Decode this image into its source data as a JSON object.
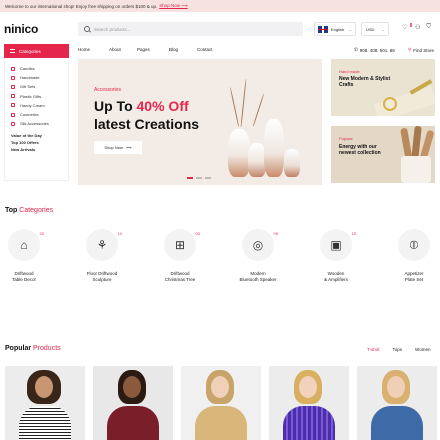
{
  "topbar": {
    "message": "Welcome to our international shop! Enjoy free shipping on orders $100 & up.",
    "link": "Shop Now"
  },
  "header": {
    "logo": "ninico",
    "search_placeholder": "Search products...",
    "language": "English",
    "currency": "USD",
    "wishlist_count": "0",
    "phone": "908. 408. 501. 89",
    "find_store": "Find Store"
  },
  "categories_button": "Categories",
  "nav": [
    "Home",
    "About",
    "Pages",
    "Blog",
    "Contact"
  ],
  "sidebar": {
    "items": [
      "Candles",
      "Handmade",
      "Gift Sets",
      "Plastic Gifts",
      "Handy Cream",
      "Cosmetics",
      "Silk Accessories"
    ],
    "extras": [
      "Value of the Day",
      "Top 100 Offers",
      "New Arrivals"
    ]
  },
  "hero": {
    "tag": "Accessories",
    "title_a": "Up To ",
    "title_accent": "40% Off",
    "title_b": "latest Creations",
    "button": "Shop Now"
  },
  "promos": [
    {
      "tag": "Hand made",
      "title": "New Modern & Stylist Crafts"
    },
    {
      "tag": "Popular",
      "title": "Energy with our newest collection"
    }
  ],
  "top_categories": {
    "title_a": "Top",
    "title_b": "Categories",
    "items": [
      {
        "label": "Driftwood\nTable Decor",
        "count": "20",
        "icon": "lamp-icon"
      },
      {
        "label": "Floor Driftwood\nSculpture",
        "count": "10",
        "icon": "sculpture-icon"
      },
      {
        "label": "Driftwood\nChristmas Tree",
        "count": "03",
        "icon": "gift-icon"
      },
      {
        "label": "Modern\nBluetooth Speaker",
        "count": "09",
        "icon": "speaker-icon"
      },
      {
        "label": "Wooden\n& Amplifiers",
        "count": "15",
        "icon": "amplifier-icon"
      },
      {
        "label": "Appetizer\nPlate Set",
        "count": "",
        "icon": "plate-icon"
      }
    ]
  },
  "popular": {
    "title_a": "Popular",
    "title_b": "Products",
    "tabs": [
      "T-shirt",
      "Tops",
      "Women"
    ]
  },
  "colors": {
    "accent": "#e5264c",
    "topbar": "#f6e3e1",
    "hero_bg": "#f3ebe6"
  }
}
